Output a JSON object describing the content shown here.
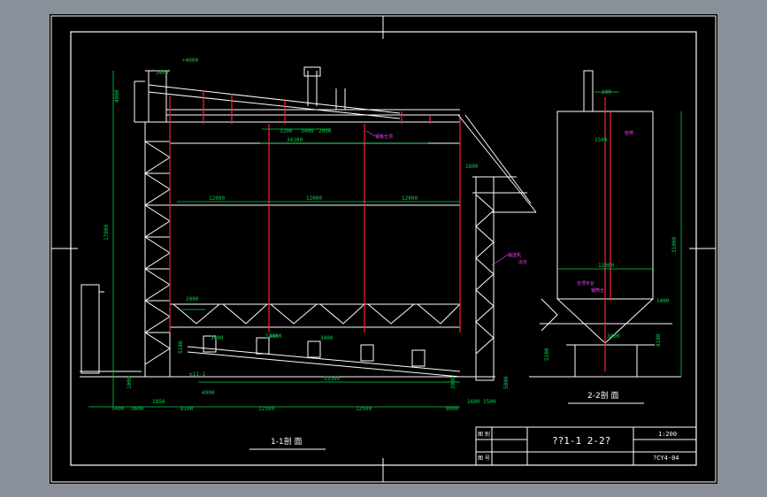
{
  "colors": {
    "background": "#8a9099",
    "sheet": "#000000",
    "frame": "#ffffff",
    "section_lines": "#ffffff",
    "vertical_members": "#ff1f3a",
    "dimensions": "#00d44a",
    "annotations": "#ff3fff",
    "title_block": "#ffffff"
  },
  "section_1": {
    "title": "1-1剖 面",
    "bottom_dims": [
      "5400",
      "3600",
      "1850",
      "8100",
      "12500",
      "12500",
      "8000",
      "1600",
      "1500"
    ],
    "top_dims": [
      "3200",
      "3400",
      "2000",
      "34100"
    ],
    "span_dims": [
      "12000",
      "12000",
      "12000"
    ],
    "height_dims": [
      "4000",
      "17000",
      "5100",
      "1000",
      "3000",
      "5000"
    ],
    "hopper_dims": [
      "2000",
      "3400",
      "3400",
      "3400"
    ],
    "mark_left": "1400",
    "mark_top": "3400",
    "mark_right": "1800",
    "elev_top": "+4000",
    "elev_low": "±11-1",
    "long_dim": "53300",
    "small_dim": "4900",
    "ann_1": "钢板仓顶",
    "ann_2": "输送机",
    "ann_3": "出仓"
  },
  "section_2": {
    "title": "2-2剖 面",
    "dims": [
      "200",
      "1500",
      "12000",
      "3400",
      "1400",
      "8100",
      "31000",
      "5100"
    ],
    "ann_1": "检修",
    "ann_2": "仓顶平台",
    "ann_3": "钢筒仓"
  },
  "title_block": {
    "row1_left": "图 别",
    "row2_left": "图 号",
    "title": "??1-1 2-2?",
    "scale": "1:200",
    "drawing_no": "?CY4-04"
  }
}
